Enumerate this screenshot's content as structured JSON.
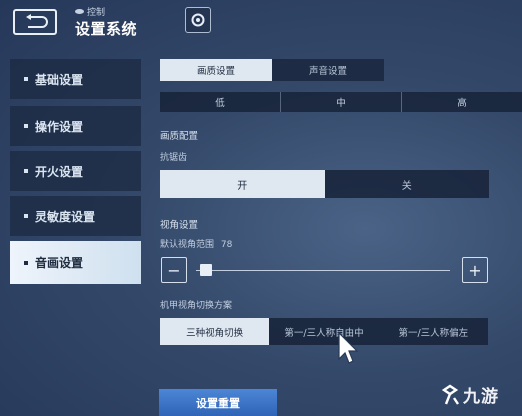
{
  "header": {
    "crumb": "控制",
    "title": "设置系统"
  },
  "sidebar": {
    "items": [
      {
        "label": "基础设置",
        "active": false
      },
      {
        "label": "操作设置",
        "active": false
      },
      {
        "label": "开火设置",
        "active": false
      },
      {
        "label": "灵敏度设置",
        "active": false
      },
      {
        "label": "音画设置",
        "active": true
      }
    ]
  },
  "tabs": [
    {
      "label": "画质设置",
      "active": true
    },
    {
      "label": "声音设置",
      "active": false
    }
  ],
  "quality": {
    "options": [
      "低",
      "中",
      "高"
    ]
  },
  "graphics": {
    "section": "画质配置",
    "antialias_label": "抗锯齿",
    "toggle": [
      {
        "label": "开",
        "active": true
      },
      {
        "label": "关",
        "active": false
      }
    ]
  },
  "view": {
    "section": "视角设置",
    "fov_label": "默认视角范围",
    "fov_value": "78",
    "fov_min": 60,
    "fov_max": 120,
    "minus": "−",
    "plus": "+",
    "switch_label": "机甲视角切换方案",
    "switch_options": [
      {
        "label": "三种视角切换",
        "active": true
      },
      {
        "label": "第一/三人称自由中",
        "active": false
      },
      {
        "label": "第一/三人称偏左",
        "active": false
      }
    ]
  },
  "reset_label": "设置重置",
  "watermark": "九游",
  "colors": {
    "accent_blue": "#3a73c8",
    "active_bg": "#dfe8f1",
    "panel_bg": "#1c2a42"
  }
}
